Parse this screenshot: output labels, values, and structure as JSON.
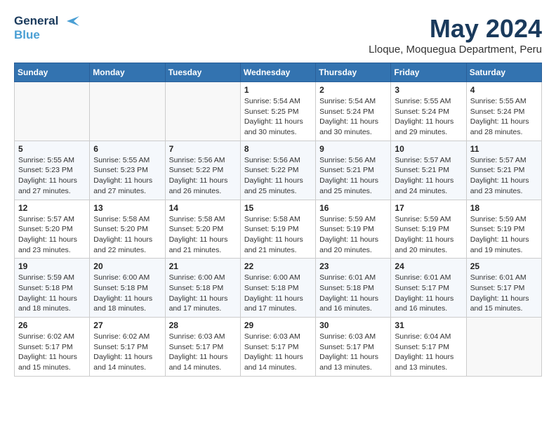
{
  "header": {
    "logo_line1": "General",
    "logo_line2": "Blue",
    "month_year": "May 2024",
    "location": "Lloque, Moquegua Department, Peru"
  },
  "weekdays": [
    "Sunday",
    "Monday",
    "Tuesday",
    "Wednesday",
    "Thursday",
    "Friday",
    "Saturday"
  ],
  "weeks": [
    [
      {
        "day": "",
        "info": ""
      },
      {
        "day": "",
        "info": ""
      },
      {
        "day": "",
        "info": ""
      },
      {
        "day": "1",
        "info": "Sunrise: 5:54 AM\nSunset: 5:25 PM\nDaylight: 11 hours\nand 30 minutes."
      },
      {
        "day": "2",
        "info": "Sunrise: 5:54 AM\nSunset: 5:24 PM\nDaylight: 11 hours\nand 30 minutes."
      },
      {
        "day": "3",
        "info": "Sunrise: 5:55 AM\nSunset: 5:24 PM\nDaylight: 11 hours\nand 29 minutes."
      },
      {
        "day": "4",
        "info": "Sunrise: 5:55 AM\nSunset: 5:24 PM\nDaylight: 11 hours\nand 28 minutes."
      }
    ],
    [
      {
        "day": "5",
        "info": "Sunrise: 5:55 AM\nSunset: 5:23 PM\nDaylight: 11 hours\nand 27 minutes."
      },
      {
        "day": "6",
        "info": "Sunrise: 5:55 AM\nSunset: 5:23 PM\nDaylight: 11 hours\nand 27 minutes."
      },
      {
        "day": "7",
        "info": "Sunrise: 5:56 AM\nSunset: 5:22 PM\nDaylight: 11 hours\nand 26 minutes."
      },
      {
        "day": "8",
        "info": "Sunrise: 5:56 AM\nSunset: 5:22 PM\nDaylight: 11 hours\nand 25 minutes."
      },
      {
        "day": "9",
        "info": "Sunrise: 5:56 AM\nSunset: 5:21 PM\nDaylight: 11 hours\nand 25 minutes."
      },
      {
        "day": "10",
        "info": "Sunrise: 5:57 AM\nSunset: 5:21 PM\nDaylight: 11 hours\nand 24 minutes."
      },
      {
        "day": "11",
        "info": "Sunrise: 5:57 AM\nSunset: 5:21 PM\nDaylight: 11 hours\nand 23 minutes."
      }
    ],
    [
      {
        "day": "12",
        "info": "Sunrise: 5:57 AM\nSunset: 5:20 PM\nDaylight: 11 hours\nand 23 minutes."
      },
      {
        "day": "13",
        "info": "Sunrise: 5:58 AM\nSunset: 5:20 PM\nDaylight: 11 hours\nand 22 minutes."
      },
      {
        "day": "14",
        "info": "Sunrise: 5:58 AM\nSunset: 5:20 PM\nDaylight: 11 hours\nand 21 minutes."
      },
      {
        "day": "15",
        "info": "Sunrise: 5:58 AM\nSunset: 5:19 PM\nDaylight: 11 hours\nand 21 minutes."
      },
      {
        "day": "16",
        "info": "Sunrise: 5:59 AM\nSunset: 5:19 PM\nDaylight: 11 hours\nand 20 minutes."
      },
      {
        "day": "17",
        "info": "Sunrise: 5:59 AM\nSunset: 5:19 PM\nDaylight: 11 hours\nand 20 minutes."
      },
      {
        "day": "18",
        "info": "Sunrise: 5:59 AM\nSunset: 5:19 PM\nDaylight: 11 hours\nand 19 minutes."
      }
    ],
    [
      {
        "day": "19",
        "info": "Sunrise: 5:59 AM\nSunset: 5:18 PM\nDaylight: 11 hours\nand 18 minutes."
      },
      {
        "day": "20",
        "info": "Sunrise: 6:00 AM\nSunset: 5:18 PM\nDaylight: 11 hours\nand 18 minutes."
      },
      {
        "day": "21",
        "info": "Sunrise: 6:00 AM\nSunset: 5:18 PM\nDaylight: 11 hours\nand 17 minutes."
      },
      {
        "day": "22",
        "info": "Sunrise: 6:00 AM\nSunset: 5:18 PM\nDaylight: 11 hours\nand 17 minutes."
      },
      {
        "day": "23",
        "info": "Sunrise: 6:01 AM\nSunset: 5:18 PM\nDaylight: 11 hours\nand 16 minutes."
      },
      {
        "day": "24",
        "info": "Sunrise: 6:01 AM\nSunset: 5:17 PM\nDaylight: 11 hours\nand 16 minutes."
      },
      {
        "day": "25",
        "info": "Sunrise: 6:01 AM\nSunset: 5:17 PM\nDaylight: 11 hours\nand 15 minutes."
      }
    ],
    [
      {
        "day": "26",
        "info": "Sunrise: 6:02 AM\nSunset: 5:17 PM\nDaylight: 11 hours\nand 15 minutes."
      },
      {
        "day": "27",
        "info": "Sunrise: 6:02 AM\nSunset: 5:17 PM\nDaylight: 11 hours\nand 14 minutes."
      },
      {
        "day": "28",
        "info": "Sunrise: 6:03 AM\nSunset: 5:17 PM\nDaylight: 11 hours\nand 14 minutes."
      },
      {
        "day": "29",
        "info": "Sunrise: 6:03 AM\nSunset: 5:17 PM\nDaylight: 11 hours\nand 14 minutes."
      },
      {
        "day": "30",
        "info": "Sunrise: 6:03 AM\nSunset: 5:17 PM\nDaylight: 11 hours\nand 13 minutes."
      },
      {
        "day": "31",
        "info": "Sunrise: 6:04 AM\nSunset: 5:17 PM\nDaylight: 11 hours\nand 13 minutes."
      },
      {
        "day": "",
        "info": ""
      }
    ]
  ]
}
